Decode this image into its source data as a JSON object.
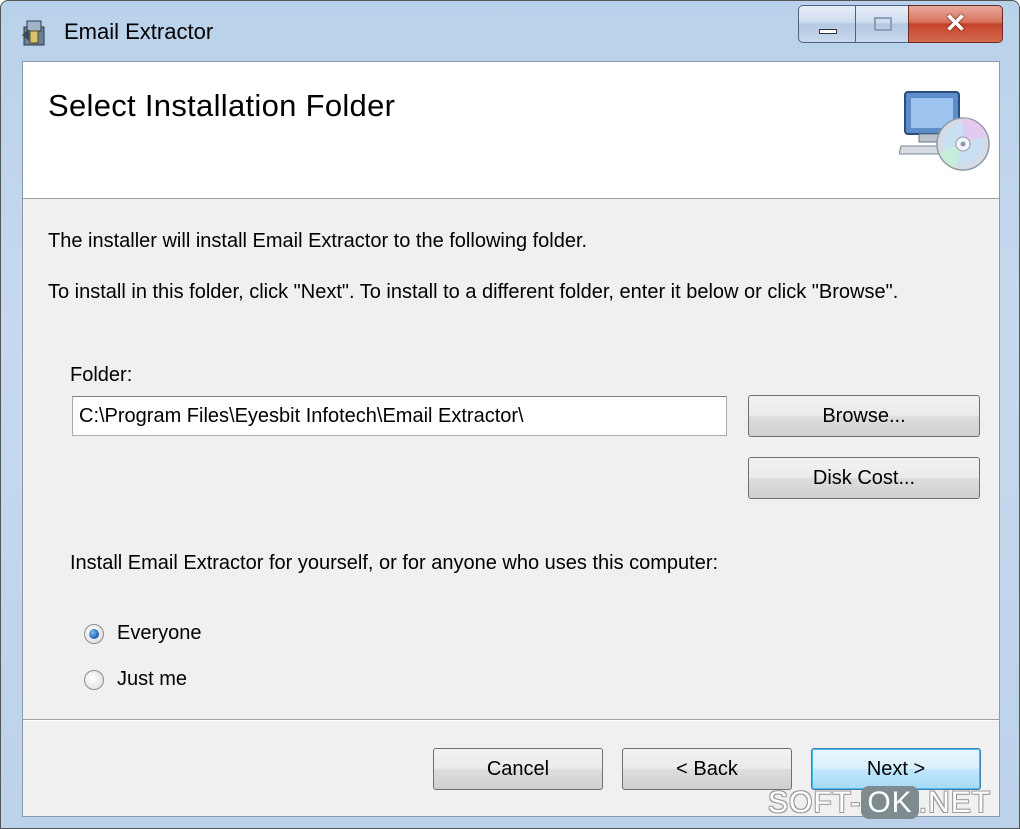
{
  "window": {
    "title": "Email Extractor",
    "controls": {
      "minimize": "minimize",
      "maximize": "maximize",
      "close": "✕"
    }
  },
  "header": {
    "heading": "Select Installation Folder",
    "icon": "computer-cd-icon"
  },
  "body": {
    "line1": "The installer will install Email Extractor to the following folder.",
    "line2": "To install in this folder, click \"Next\". To install to a different folder, enter it below or click \"Browse\".",
    "folder_label": "Folder:",
    "folder_value": "C:\\Program Files\\Eyesbit Infotech\\Email Extractor\\",
    "browse_label": "Browse...",
    "disk_cost_label": "Disk Cost...",
    "install_for_text": "Install Email Extractor for yourself, or for anyone who uses this computer:",
    "options": [
      {
        "label": "Everyone",
        "selected": true
      },
      {
        "label": "Just me",
        "selected": false
      }
    ]
  },
  "footer": {
    "cancel_label": "Cancel",
    "back_label": "< Back",
    "next_label": "Next >"
  },
  "watermark": {
    "prefix": "SOFT-",
    "ok": "OK",
    "suffix": ".NET"
  },
  "colors": {
    "titlebar": "#b9d1ea",
    "close_button": "#c4432b",
    "dialog_background": "#f0f0f0",
    "header_background": "#ffffff",
    "default_button_border": "#3c7fb1"
  }
}
